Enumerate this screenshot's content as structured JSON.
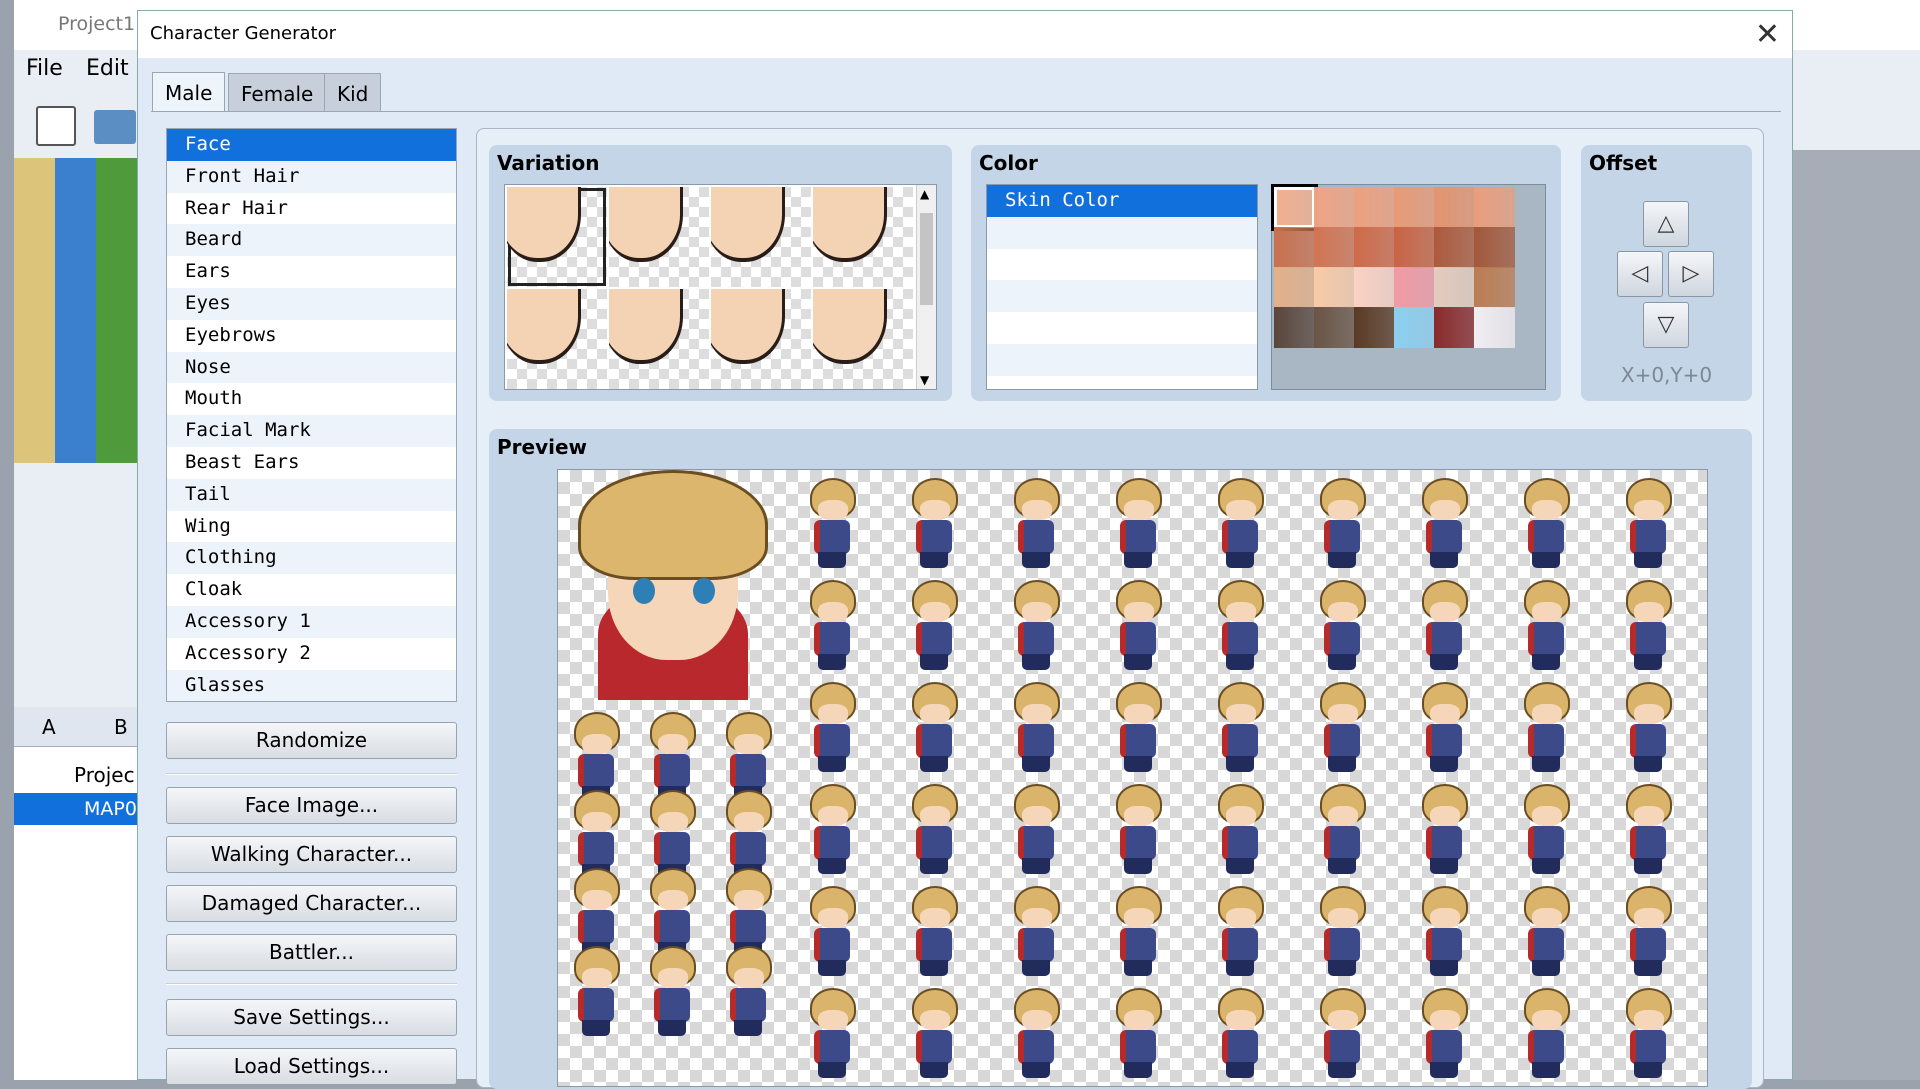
{
  "background_app": {
    "title": "Project1 -",
    "menu": [
      "File",
      "Edit"
    ],
    "tabs": [
      "A",
      "B"
    ],
    "tree": [
      "Projec",
      "MAP0"
    ]
  },
  "dialog": {
    "title": "Character Generator",
    "tabs": [
      {
        "label": "Male",
        "active": true
      },
      {
        "label": "Female",
        "active": false
      },
      {
        "label": "Kid",
        "active": false
      }
    ],
    "parts": [
      "Face",
      "Front Hair",
      "Rear Hair",
      "Beard",
      "Ears",
      "Eyes",
      "Eyebrows",
      "Nose",
      "Mouth",
      "Facial Mark",
      "Beast Ears",
      "Tail",
      "Wing",
      "Clothing",
      "Cloak",
      "Accessory 1",
      "Accessory 2",
      "Glasses"
    ],
    "selected_part": "Face",
    "buttons": {
      "randomize": "Randomize",
      "face_image": "Face Image...",
      "walking": "Walking Character...",
      "damaged": "Damaged Character...",
      "battler": "Battler...",
      "save": "Save Settings...",
      "load": "Load Settings..."
    },
    "variation": {
      "title": "Variation",
      "selected_index": 0
    },
    "color": {
      "title": "Color",
      "items": [
        "Skin Color"
      ],
      "palette": [
        [
          "#f3b08e",
          "#f0a482",
          "#eea07e",
          "#e99a76",
          "#e4946e",
          "#e99e7c"
        ],
        [
          "#c9704e",
          "#d27452",
          "#cf6a48",
          "#c86444",
          "#ad5a3c",
          "#a3583a"
        ],
        [
          "#e3b08a",
          "#f8cba8",
          "#fbd2c4",
          "#f29aa4",
          "#e4cbbc",
          "#bb7c52"
        ],
        [
          "#5a463c",
          "#6a5444",
          "#5a3a24",
          "#8ccff0",
          "#8a2a2c",
          "#f2eef2"
        ]
      ],
      "selected_swatch": [
        0,
        0
      ]
    },
    "offset": {
      "title": "Offset",
      "value": "X+0,Y+0"
    },
    "preview": {
      "title": "Preview"
    },
    "colors": {
      "selection": "#1270dc",
      "group": "#c4d5e8"
    }
  }
}
